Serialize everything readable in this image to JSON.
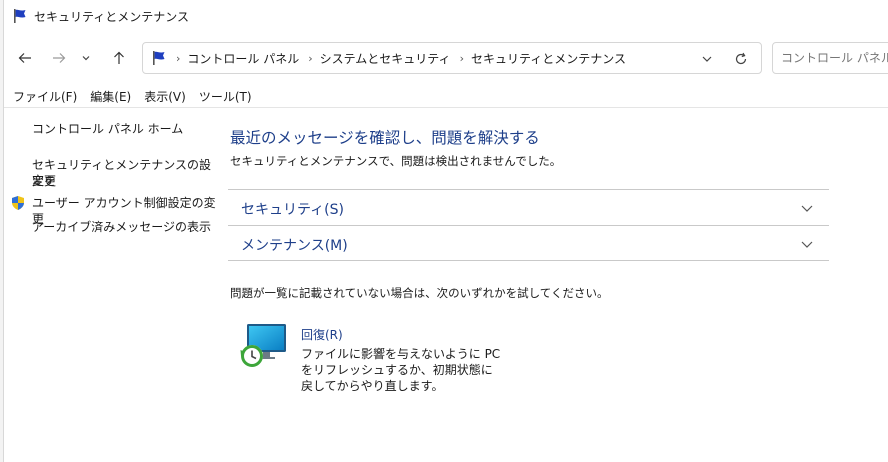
{
  "window": {
    "title": "セキュリティとメンテナンス",
    "icon": "flag-icon"
  },
  "navigation": {
    "back_icon": "arrow-left-icon",
    "forward_icon": "arrow-right-icon",
    "recent_icon": "chevron-down-icon",
    "up_icon": "arrow-up-icon",
    "breadcrumb": [
      "コントロール パネル",
      "システムとセキュリティ",
      "セキュリティとメンテナンス"
    ],
    "breadcrumb_separator": "›",
    "search_placeholder": "コントロール パネルの検"
  },
  "menubar": {
    "items": [
      "ファイル(F)",
      "編集(E)",
      "表示(V)",
      "ツール(T)"
    ]
  },
  "sidebar": {
    "home_link": "コントロール パネル ホーム",
    "settings_link_line1": "セキュリティとメンテナンスの設定を",
    "settings_link_line2": "変更",
    "uac_link": "ユーザー アカウント制御設定の変更",
    "archive_link": "アーカイブ済みメッセージの表示"
  },
  "main": {
    "title": "最近のメッセージを確認し、問題を解決する",
    "subtitle": "セキュリティとメンテナンスで、問題は検出されませんでした。",
    "sections": [
      {
        "label": "セキュリティ(S)"
      },
      {
        "label": "メンテナンス(M)"
      }
    ],
    "trouble_text": "問題が一覧に記載されていない場合は、次のいずれかを試してください。",
    "recovery": {
      "title": "回復(R)",
      "description": "ファイルに影響を与えないように PC をリフレッシュするか、初期状態に戻してからやり直します。"
    }
  },
  "colors": {
    "link_blue": "#1e3f8a",
    "divider": "#c9c9c9",
    "flag_blue": "#1f3fbf"
  }
}
